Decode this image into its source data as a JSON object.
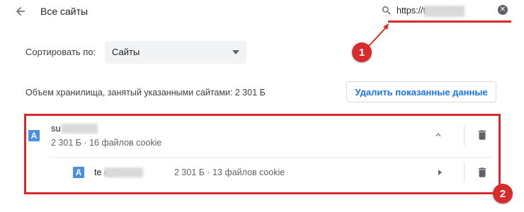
{
  "header": {
    "title": "Все сайты",
    "search_value": "https://tes            op3...."
  },
  "sort": {
    "label": "Сортировать по:",
    "selected": "Сайты"
  },
  "storage": {
    "text": "Объем хранилища, занятый указанными сайтами: 2 301 Б",
    "delete_label": "Удалить показанные данные"
  },
  "sites": [
    {
      "favicon_letter": "A",
      "name": "su          .ru",
      "meta": "2 301 Б · 16 файлов cookie"
    },
    {
      "favicon_letter": "A",
      "name": "te             op3.ru",
      "meta": "2 301 Б · 13 файлов cookie"
    }
  ],
  "annotations": {
    "badge1": "1",
    "badge2": "2"
  },
  "colors": {
    "annotation": "#d92b2b",
    "accent": "#1a73e8",
    "favicon": "#4a90e2"
  },
  "icons": [
    "back-arrow-icon",
    "search-icon",
    "clear-icon",
    "dropdown-arrow-icon",
    "chevron-up-icon",
    "chevron-right-icon",
    "trash-icon",
    "site-favicon-icon"
  ]
}
